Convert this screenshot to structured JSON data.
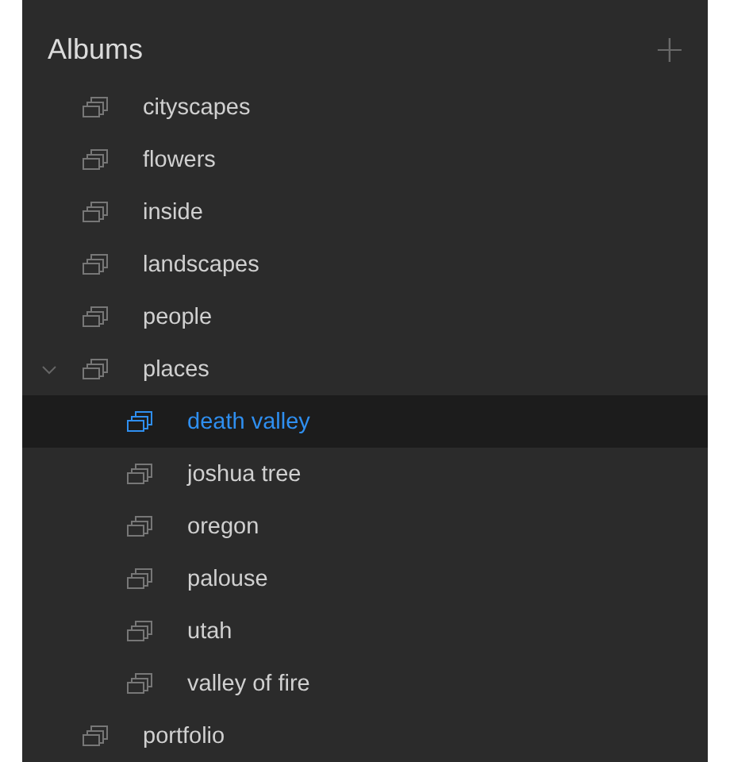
{
  "panel": {
    "title": "Albums",
    "add_button": "+"
  },
  "albums": [
    {
      "label": "cityscapes",
      "selected": false
    },
    {
      "label": "flowers",
      "selected": false
    },
    {
      "label": "inside",
      "selected": false
    },
    {
      "label": "landscapes",
      "selected": false
    },
    {
      "label": "people",
      "selected": false
    },
    {
      "label": "places",
      "selected": false,
      "expanded": true,
      "children": [
        {
          "label": "death valley",
          "selected": true
        },
        {
          "label": "joshua tree",
          "selected": false
        },
        {
          "label": "oregon",
          "selected": false
        },
        {
          "label": "palouse",
          "selected": false
        },
        {
          "label": "utah",
          "selected": false
        },
        {
          "label": "valley of fire",
          "selected": false
        }
      ]
    },
    {
      "label": "portfolio",
      "selected": false
    }
  ]
}
